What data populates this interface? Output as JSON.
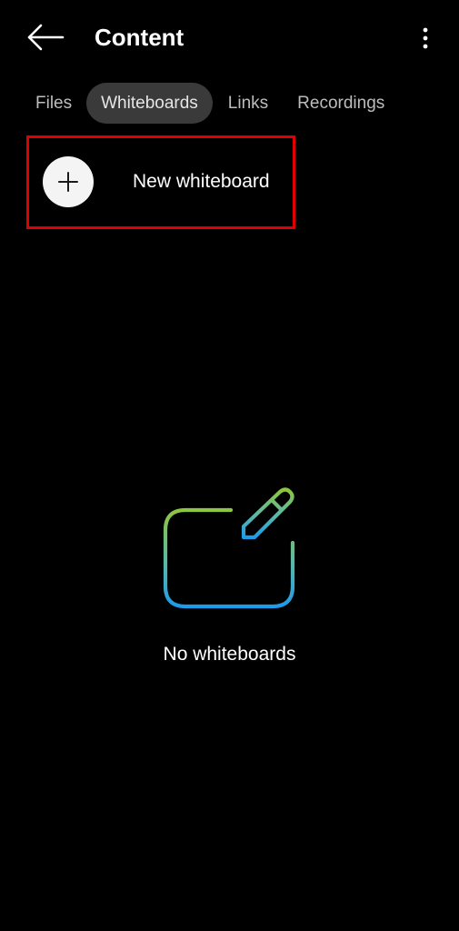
{
  "header": {
    "title": "Content",
    "back_icon": "arrow-left-icon",
    "more_icon": "more-vertical-icon"
  },
  "tabs": [
    {
      "label": "Files",
      "active": false
    },
    {
      "label": "Whiteboards",
      "active": true
    },
    {
      "label": "Links",
      "active": false
    },
    {
      "label": "Recordings",
      "active": false
    }
  ],
  "new_whiteboard": {
    "label": "New whiteboard",
    "icon": "plus-icon"
  },
  "empty_state": {
    "icon": "whiteboard-pen-icon",
    "message": "No whiteboards"
  },
  "colors": {
    "background": "#000000",
    "active_tab_bg": "#3a3a3a",
    "highlight_border": "#e00000",
    "icon_gradient_top": "#8cc63f",
    "icon_gradient_bottom": "#1e9be8"
  }
}
